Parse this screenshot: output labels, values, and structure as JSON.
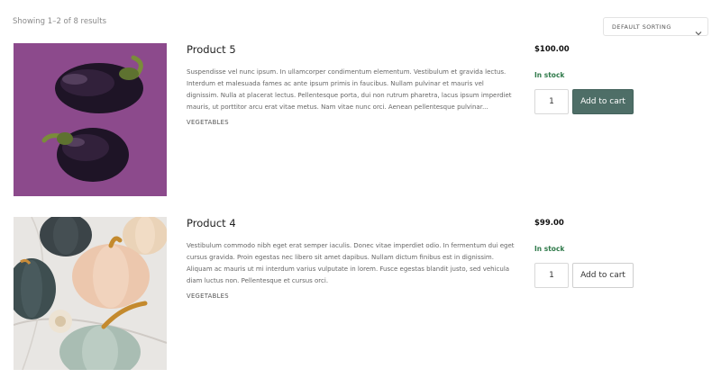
{
  "results_count": "Showing 1–2 of 8 results",
  "sorting": {
    "selected": "DEFAULT SORTING"
  },
  "products": [
    {
      "title": "Product 5",
      "description": "Suspendisse vel nunc ipsum. In ullamcorper condimentum elementum. Vestibulum et gravida lectus. Interdum et malesuada fames ac ante ipsum primis in faucibus. Nullam pulvinar et mauris vel dignissim. Nulla at placerat lectus. Pellentesque porta, dui non rutrum pharetra, lacus ipsum imperdiet mauris, ut porttitor arcu erat vitae metus. Nam vitae nunc orci. Aenean pellentesque pulvinar...",
      "category": "VEGETABLES",
      "price": "$100.00",
      "stock": "In stock",
      "quantity": "1",
      "button_label": "Add to cart",
      "image": "purple-bell-peppers"
    },
    {
      "title": "Product 4",
      "description": "Vestibulum commodo nibh eget erat semper iaculis. Donec vitae imperdiet odio. In fermentum dui eget cursus gravida. Proin egestas nec libero sit amet dapibus. Nullam dictum finibus est in dignissim. Aliquam ac mauris ut mi interdum varius vulputate in lorem. Fusce egestas blandit justo, sed vehicula diam luctus non. Pellentesque et cursus orci.",
      "category": "VEGETABLES",
      "price": "$99.00",
      "stock": "In stock",
      "quantity": "1",
      "button_label": "Add to cart",
      "image": "pumpkins-on-marble"
    }
  ],
  "colors": {
    "button_primary": "#4e6e67",
    "stock_green": "#2f7a4a",
    "purple_background": "#8c4a8c"
  }
}
